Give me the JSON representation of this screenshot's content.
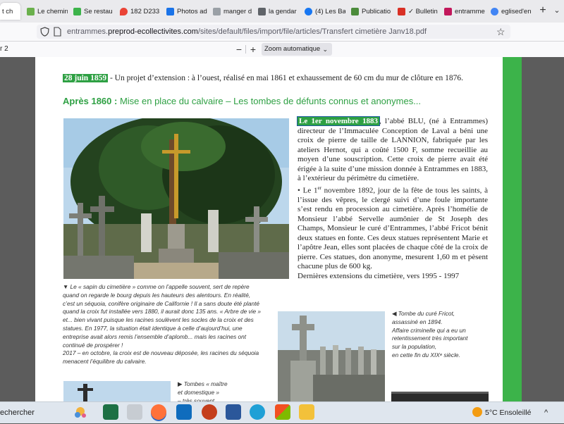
{
  "browser": {
    "tabs": [
      {
        "label": "t ch",
        "color": "#8c8c8c",
        "active": true
      },
      {
        "label": "Le chemin",
        "color": "#6ab04c"
      },
      {
        "label": "Se restau",
        "color": "#3cb34a"
      },
      {
        "label": "182 D233",
        "color": "#ea4335"
      },
      {
        "label": "Photos ad",
        "color": "#1a73e8"
      },
      {
        "label": "manger d",
        "color": "#9aa0a6"
      },
      {
        "label": "la gendar",
        "color": "#5f6368"
      },
      {
        "label": "(4) Les Ba",
        "color": "#1877f2"
      },
      {
        "label": "Publicatio",
        "color": "#4b8b3b"
      },
      {
        "label": "✓ Bulletin",
        "color": "#d93025"
      },
      {
        "label": "entramme",
        "color": "#c2185b"
      },
      {
        "label": "eglised'en",
        "color": "#4285f4"
      }
    ],
    "new_tab_symbol": "+",
    "tab_list_symbol": "⌄",
    "url": {
      "prefix": "entrammes.",
      "host": "preprod-ecollectivites.com",
      "path": "/sites/default/files/import/file/articles/Transfert cimetière Janv18.pdf"
    },
    "bookmark_symbol": "☆"
  },
  "pdf_toolbar": {
    "page_info": "r 2",
    "zoom_out_symbol": "−",
    "zoom_in_symbol": "+",
    "zoom_value": "Zoom automatique"
  },
  "document": {
    "line1": {
      "date": "28 juin 1859",
      "text": " - Un projet d’extension : à l’ouest, réalisé en mai 1861 et exhaussement de 60 cm du mur de clôture en 1876."
    },
    "heading": {
      "date": "Après 1860 :",
      "text": " Mise en place du calvaire – Les tombes de défunts connus et anonymes..."
    },
    "paragraph1": {
      "date": "Le 1er novembre 1883",
      "text": ", l’abbé BLU, (né à Entrammes) directeur de l’Immaculée Conception de Laval a béni une croix de pierre de taille de LANNION, fabriquée par les ateliers Hernot, qui a coûté 1500 F, somme recueillie au moyen d’une souscription. Cette croix de pierre avait été érigée à la suite d’une mission donnée à Entrammes en 1883, à l’extérieur du périmètre du cimetière."
    },
    "paragraph2": {
      "bullet": "• Le 1",
      "sup": "er",
      "text": " novembre 1892, jour de la fête de tous les saints, à l’issue des vêpres, le clergé suivi d’une foule importante s’est rendu en procession au cimetière. Après l’homélie de Monsieur l’abbé Servelle aumônier de St Joseph des Champs, Monsieur le curé d’Entrammes, l’abbé Fricot bénit deux statues en fonte. Ces deux statues représentent Marie et l’apôtre Jean, elles sont placées de chaque côté de la croix de pierre. Ces statues, don anonyme, mesurent 1,60 m et pèsent chacune plus de 600 kg."
    },
    "paragraph3": "Dernières extensions du cimetière, vers 1995 - 1997",
    "caption1": {
      "marker": "▼",
      "text": " Le « sapin du cimetière » comme on l’appelle souvent, sert de repère quand on regarde le bourg depuis les hauteurs des alentours. En réalité, c’est un séquoia, conifère originaire de Californie ! Il a sans doute été planté quand la croix fut installée vers 1880, il aurait donc 135 ans. « Arbre de vie » et... bien vivant puisque les racines soulèvent les socles de la croix et des statues. En 1977, la situation était identique à celle d’aujourd’hui, une entreprise avait alors remis l’ensemble d’aplomb... mais les racines ont continué de prospérer !",
      "text2": "2017 – en octobre, la croix est de nouveau déposée, les racines du séquoia menacent l’équilibre du calvaire."
    },
    "caption2": {
      "marker": "◀",
      "lines": [
        "Tombe du curé Fricot,",
        "assassiné en 1894.",
        "Affaire criminelle qui a eu un",
        "retentissement très important",
        "sur la population,",
        "en cette fin du XIXᵉ siècle."
      ]
    },
    "caption3": {
      "marker": "▶",
      "lines": [
        "Tombes « maître",
        "et domestique »",
        "– très souvent"
      ]
    }
  },
  "taskbar": {
    "search_label": "echercher",
    "weather": {
      "temp": "5°C",
      "condition": "Ensoleillé"
    },
    "overflow_symbol": "^"
  },
  "colors": {
    "accent_green": "#2ea043",
    "sidebar_green": "#3cb34a"
  }
}
